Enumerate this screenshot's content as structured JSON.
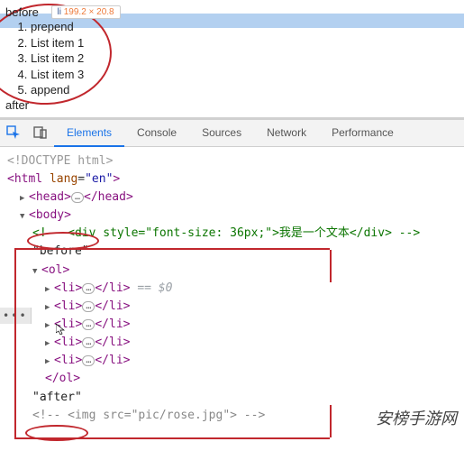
{
  "preview": {
    "before": "before",
    "after": "after",
    "tooltip_tag": "li",
    "tooltip_size": "199.2 × 20.8",
    "items": [
      "prepend",
      "List item 1",
      "List item 2",
      "List item 3",
      "append"
    ]
  },
  "toolbar": {
    "tabs": [
      "Elements",
      "Console",
      "Sources",
      "Network",
      "Performance"
    ],
    "active_index": 0
  },
  "dom": {
    "doctype": "<!DOCTYPE html>",
    "html_open": "<html lang=\"en\">",
    "head_open": "<head>",
    "head_close": "</head>",
    "body_open": "<body>",
    "comment_div": "<!-- <div style=\"font-size: 36px;\">我是一个文本</div> -->",
    "text_before": "\"before\"",
    "ol_open": "<ol>",
    "ol_close": "</ol>",
    "li_open": "<li>",
    "li_close": "</li>",
    "selected_marker": "== $0",
    "text_after": "\"after\"",
    "comment_img": "<!-- <img src=\"pic/rose.jpg\"> -->",
    "pill": "…",
    "gutter": "•••"
  },
  "watermark": "安榜手游网"
}
